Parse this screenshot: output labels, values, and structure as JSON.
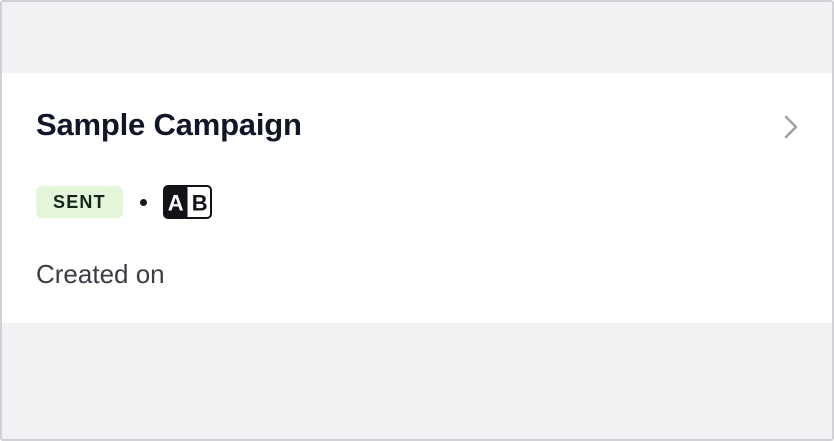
{
  "campaign": {
    "title": "Sample Campaign",
    "status_badge": "SENT",
    "separator": "•",
    "test_icon": "ab-test-icon",
    "test_icon_letters": [
      "A",
      "B"
    ],
    "created_label": "Created on",
    "chevron_icon": "chevron-right-icon"
  },
  "colors": {
    "page_background": "#f1f2f4",
    "card_background": "#ffffff",
    "badge_background": "#e3f6d9",
    "title_text": "#0f1729",
    "muted_text": "#3a3d45",
    "chevron": "#9ea3ab"
  }
}
